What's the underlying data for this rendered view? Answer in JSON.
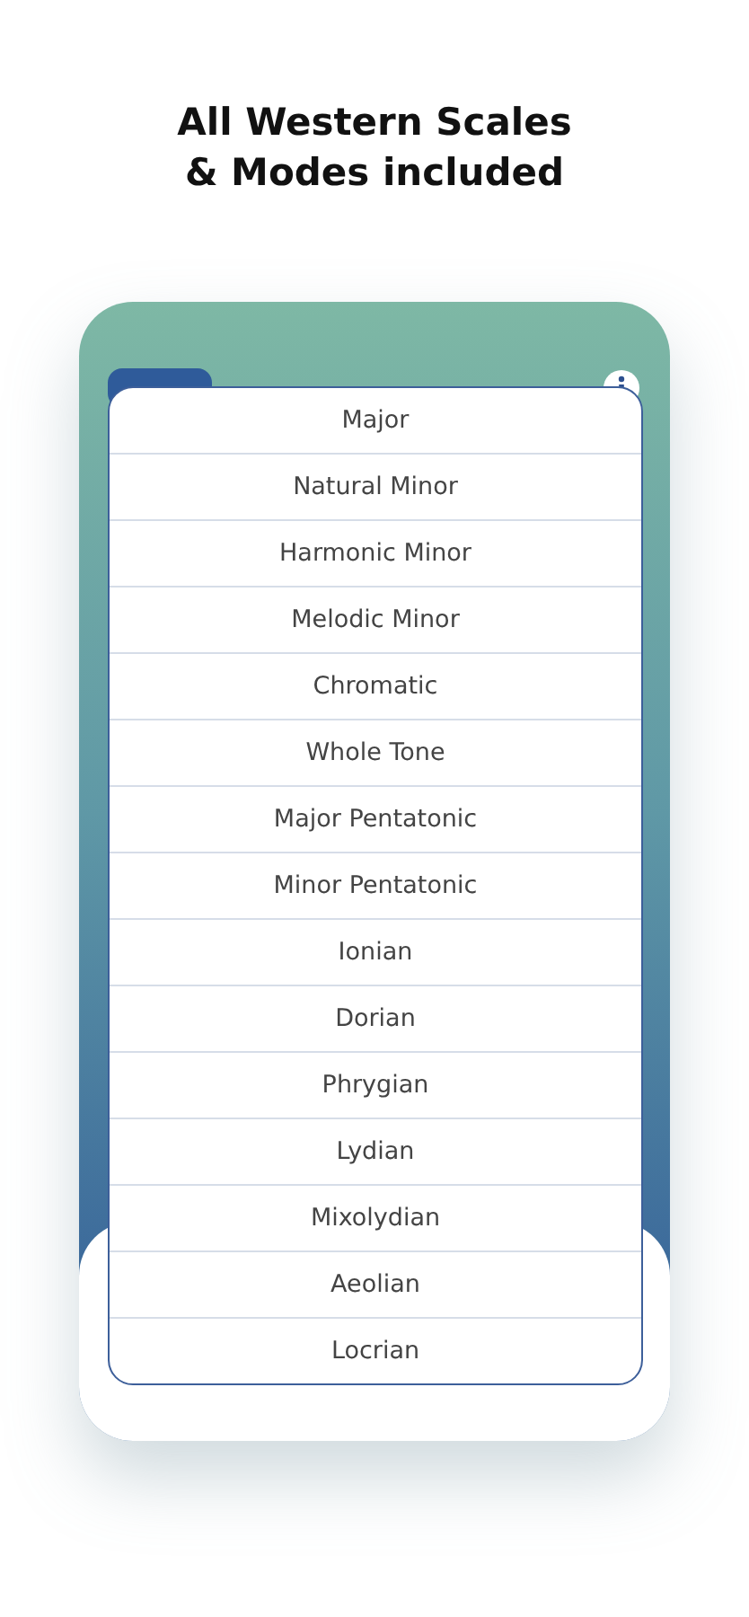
{
  "headline": [
    "All Western Scales",
    "& Modes included"
  ],
  "scale_list": [
    {
      "label": "Major"
    },
    {
      "label": "Natural Minor"
    },
    {
      "label": "Harmonic Minor"
    },
    {
      "label": "Melodic Minor"
    },
    {
      "label": "Chromatic"
    },
    {
      "label": "Whole Tone"
    },
    {
      "label": "Major Pentatonic"
    },
    {
      "label": "Minor Pentatonic"
    },
    {
      "label": "Ionian"
    },
    {
      "label": "Dorian"
    },
    {
      "label": "Phrygian"
    },
    {
      "label": "Lydian"
    },
    {
      "label": "Mixolydian"
    },
    {
      "label": "Aeolian"
    },
    {
      "label": "Locrian"
    }
  ]
}
